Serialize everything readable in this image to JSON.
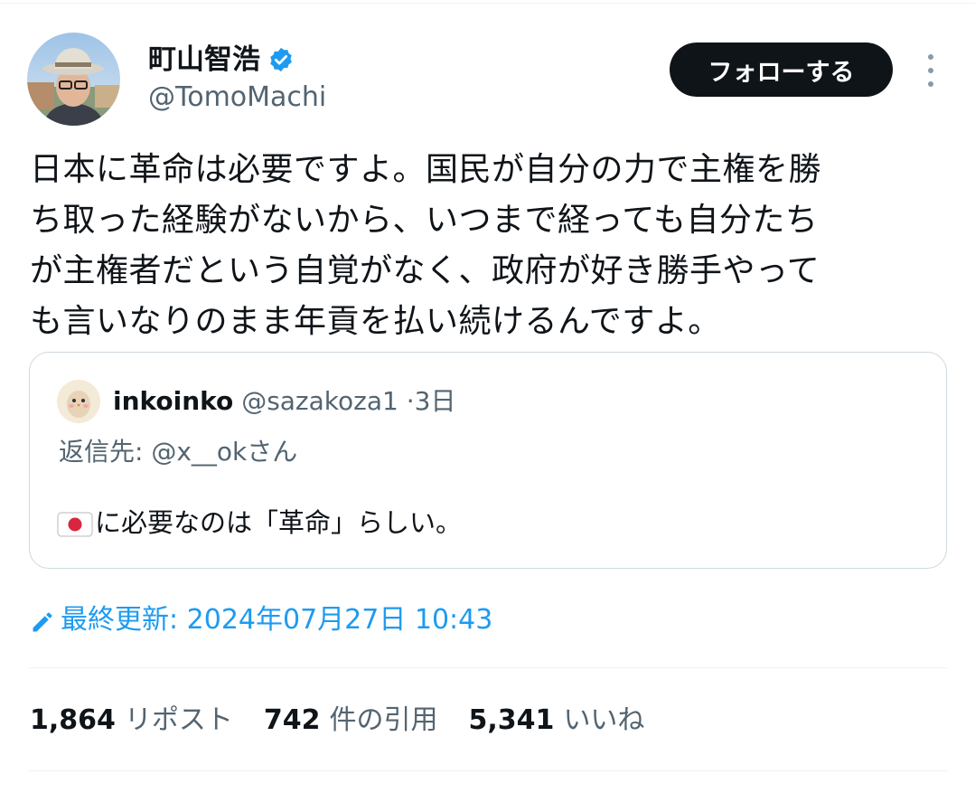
{
  "author": {
    "display_name": "町山智浩",
    "handle": "@TomoMachi",
    "verified": true,
    "avatar_icon": "profile-photo-man-with-hat"
  },
  "follow_button": {
    "label": "フォローする"
  },
  "more_icon": "more-vertical-icon",
  "tweet": {
    "text": "日本に革命は必要ですよ。国民が自分の力で主権を勝\nち取った経験がないから、いつまで経っても自分たち\nが主権者だという自覚がなく、政府が好き勝手やって\nも言いなりのまま年貢を払い続けるんですよ。"
  },
  "quote": {
    "name": "inkoinko",
    "handle": "@sazakoza1",
    "separator": "·",
    "time": "3日",
    "reply_to": "返信先: @x__okさん",
    "text": "に必要なのは「革命」らしい。",
    "flag_icon": "japan-flag-emoji"
  },
  "updated": {
    "label": "最終更新: 2024年07月27日 10:43",
    "icon": "pencil-icon"
  },
  "stats": {
    "reposts_count": "1,864",
    "reposts_label": "リポスト",
    "quotes_count": "742",
    "quotes_label": "件の引用",
    "likes_count": "5,341",
    "likes_label": "いいね"
  },
  "colors": {
    "text_primary": "#0f1419",
    "text_secondary": "#536471",
    "accent_blue": "#1d9bf0",
    "border": "#cfd9de",
    "divider": "#eff3f4",
    "follow_bg": "#0f1419",
    "verified_badge": "#1d9bf0"
  }
}
